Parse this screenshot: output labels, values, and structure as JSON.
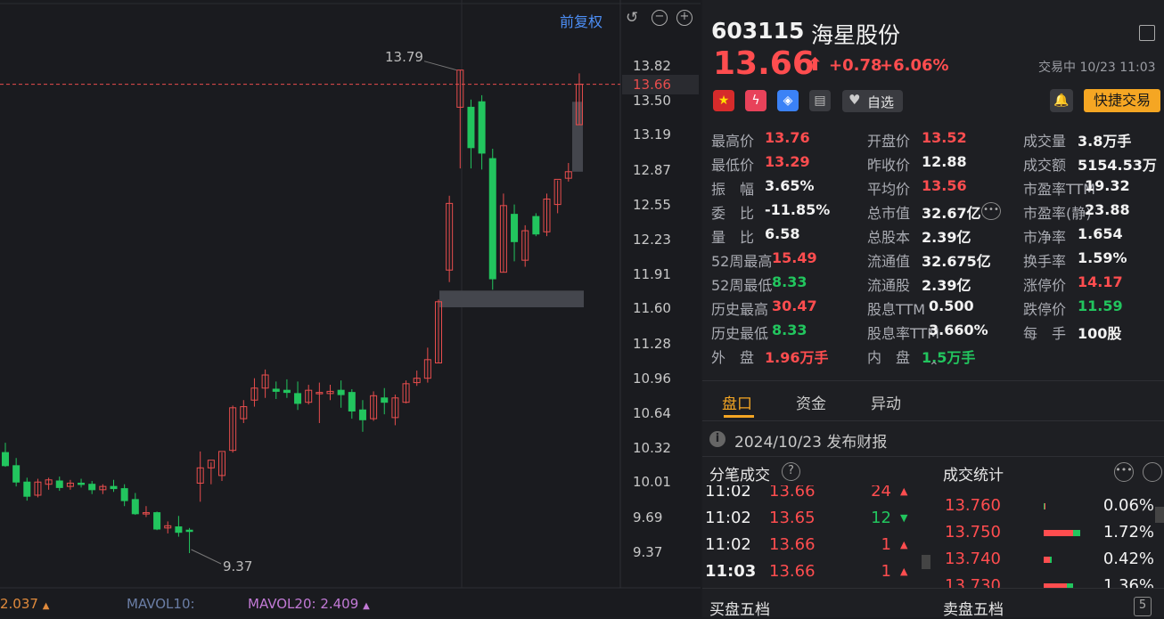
{
  "chart": {
    "adjust_label": "前复权",
    "price_ticks": [
      "13.82",
      "13.50",
      "13.19",
      "12.87",
      "12.55",
      "12.23",
      "11.91",
      "11.60",
      "11.28",
      "10.96",
      "10.64",
      "10.32",
      "10.01",
      "9.69",
      "9.37"
    ],
    "current_price_tag": "13.66",
    "high_marker": "13.79",
    "low_marker": "9.37",
    "vol_indicators": {
      "v1": "2.037",
      "mavol10_label": "MAVOL10:",
      "mavol20_label": "MAVOL20:",
      "mavol20_value": "2.409"
    },
    "colors": {
      "up": "#e84d4d",
      "down": "#22c55e",
      "price_line": "#e84d4d"
    }
  },
  "chart_data": {
    "type": "candlestick",
    "ylim": [
      9.37,
      13.82
    ],
    "candles": [
      {
        "o": 10.29,
        "h": 10.38,
        "l": 10.16,
        "c": 10.17
      },
      {
        "o": 10.17,
        "h": 10.24,
        "l": 9.98,
        "c": 10.02
      },
      {
        "o": 10.02,
        "h": 10.06,
        "l": 9.85,
        "c": 9.89
      },
      {
        "o": 9.9,
        "h": 10.05,
        "l": 9.88,
        "c": 10.02
      },
      {
        "o": 10.0,
        "h": 10.06,
        "l": 9.95,
        "c": 10.04
      },
      {
        "o": 10.03,
        "h": 10.07,
        "l": 9.94,
        "c": 9.97
      },
      {
        "o": 9.98,
        "h": 10.04,
        "l": 9.95,
        "c": 10.01
      },
      {
        "o": 10.01,
        "h": 10.05,
        "l": 9.97,
        "c": 10.0
      },
      {
        "o": 10.0,
        "h": 10.03,
        "l": 9.91,
        "c": 9.95
      },
      {
        "o": 9.95,
        "h": 10.0,
        "l": 9.91,
        "c": 9.98
      },
      {
        "o": 9.98,
        "h": 10.04,
        "l": 9.93,
        "c": 9.96
      },
      {
        "o": 9.96,
        "h": 10.0,
        "l": 9.8,
        "c": 9.85
      },
      {
        "o": 9.86,
        "h": 9.92,
        "l": 9.72,
        "c": 9.73
      },
      {
        "o": 9.74,
        "h": 9.8,
        "l": 9.7,
        "c": 9.74
      },
      {
        "o": 9.74,
        "h": 9.75,
        "l": 9.58,
        "c": 9.59
      },
      {
        "o": 9.6,
        "h": 9.66,
        "l": 9.55,
        "c": 9.62
      },
      {
        "o": 9.61,
        "h": 9.71,
        "l": 9.52,
        "c": 9.56
      },
      {
        "o": 9.58,
        "h": 9.6,
        "l": 9.37,
        "c": 9.57
      },
      {
        "o": 10.01,
        "h": 10.3,
        "l": 9.84,
        "c": 10.15
      },
      {
        "o": 10.15,
        "h": 10.2,
        "l": 10.0,
        "c": 10.22
      },
      {
        "o": 10.08,
        "h": 10.29,
        "l": 10.03,
        "c": 10.3
      },
      {
        "o": 10.31,
        "h": 10.72,
        "l": 10.29,
        "c": 10.7
      },
      {
        "o": 10.6,
        "h": 10.77,
        "l": 10.56,
        "c": 10.71
      },
      {
        "o": 10.77,
        "h": 10.97,
        "l": 10.71,
        "c": 10.88
      },
      {
        "o": 10.88,
        "h": 11.05,
        "l": 10.79,
        "c": 11.0
      },
      {
        "o": 10.87,
        "h": 10.94,
        "l": 10.78,
        "c": 10.85
      },
      {
        "o": 10.86,
        "h": 10.96,
        "l": 10.79,
        "c": 10.84
      },
      {
        "o": 10.83,
        "h": 10.94,
        "l": 10.68,
        "c": 10.74
      },
      {
        "o": 10.75,
        "h": 10.91,
        "l": 10.73,
        "c": 10.86
      },
      {
        "o": 10.84,
        "h": 10.93,
        "l": 10.56,
        "c": 10.84
      },
      {
        "o": 10.83,
        "h": 10.91,
        "l": 10.77,
        "c": 10.85
      },
      {
        "o": 10.86,
        "h": 10.95,
        "l": 10.7,
        "c": 10.82
      },
      {
        "o": 10.84,
        "h": 10.87,
        "l": 10.6,
        "c": 10.67
      },
      {
        "o": 10.68,
        "h": 10.77,
        "l": 10.48,
        "c": 10.59
      },
      {
        "o": 10.6,
        "h": 10.85,
        "l": 10.58,
        "c": 10.81
      },
      {
        "o": 10.79,
        "h": 10.88,
        "l": 10.64,
        "c": 10.75
      },
      {
        "o": 10.61,
        "h": 10.82,
        "l": 10.54,
        "c": 10.79
      },
      {
        "o": 10.75,
        "h": 10.95,
        "l": 10.74,
        "c": 10.92
      },
      {
        "o": 10.93,
        "h": 11.04,
        "l": 10.9,
        "c": 10.97
      },
      {
        "o": 10.97,
        "h": 11.25,
        "l": 10.93,
        "c": 11.14
      },
      {
        "o": 11.11,
        "h": 11.69,
        "l": 11.11,
        "c": 11.67
      },
      {
        "o": 11.96,
        "h": 12.64,
        "l": 11.85,
        "c": 12.57
      },
      {
        "o": 13.45,
        "h": 13.79,
        "l": 12.89,
        "c": 13.79
      },
      {
        "o": 13.45,
        "h": 13.52,
        "l": 12.89,
        "c": 13.08
      },
      {
        "o": 13.5,
        "h": 13.56,
        "l": 12.88,
        "c": 13.03
      },
      {
        "o": 12.98,
        "h": 13.07,
        "l": 11.78,
        "c": 11.88
      },
      {
        "o": 11.94,
        "h": 12.66,
        "l": 11.94,
        "c": 12.55
      },
      {
        "o": 12.47,
        "h": 12.56,
        "l": 12.04,
        "c": 12.22
      },
      {
        "o": 12.05,
        "h": 12.37,
        "l": 11.99,
        "c": 12.32
      },
      {
        "o": 12.45,
        "h": 12.48,
        "l": 12.27,
        "c": 12.29
      },
      {
        "o": 12.31,
        "h": 12.66,
        "l": 12.27,
        "c": 12.61
      },
      {
        "o": 12.56,
        "h": 12.78,
        "l": 12.48,
        "c": 12.79
      },
      {
        "o": 12.8,
        "h": 12.94,
        "l": 12.77,
        "c": 12.86
      },
      {
        "o": 13.29,
        "h": 13.76,
        "l": 13.29,
        "c": 13.66
      }
    ]
  },
  "quote": {
    "code": "603115",
    "name": "海星股份",
    "price": "13.66",
    "arrow": "⬆",
    "change": "+0.78",
    "change_pct": "+6.06%",
    "status": "交易中 10/23 11:03",
    "watch_label": "自选",
    "quick_trade": "快捷交易",
    "fields": [
      {
        "label": "最高价",
        "value": "13.76",
        "color": "red"
      },
      {
        "label": "开盘价",
        "value": "13.52",
        "color": "red"
      },
      {
        "label": "成交量",
        "value": "3.8万手",
        "color": "white"
      },
      {
        "label": "最低价",
        "value": "13.29",
        "color": "red"
      },
      {
        "label": "昨收价",
        "value": "12.88",
        "color": "white"
      },
      {
        "label": "成交额",
        "value": "5154.53万",
        "color": "white"
      },
      {
        "label": "振　幅",
        "value": "3.65%",
        "color": "white"
      },
      {
        "label": "平均价",
        "value": "13.56",
        "color": "red"
      },
      {
        "label": "市盈率TTM",
        "value": "19.32",
        "color": "white"
      },
      {
        "label": "委　比",
        "value": "-11.85%",
        "color": "white"
      },
      {
        "label": "总市值",
        "value": "32.67亿",
        "color": "white"
      },
      {
        "label": "市盈率(静)",
        "value": "23.88",
        "color": "white"
      },
      {
        "label": "量　比",
        "value": "6.58",
        "color": "white"
      },
      {
        "label": "总股本",
        "value": "2.39亿",
        "color": "white"
      },
      {
        "label": "市净率",
        "value": "1.654",
        "color": "white"
      },
      {
        "label": "52周最高",
        "value": "15.49",
        "color": "red"
      },
      {
        "label": "流通值",
        "value": "32.675亿",
        "color": "white"
      },
      {
        "label": "换手率",
        "value": "1.59%",
        "color": "white"
      },
      {
        "label": "52周最低",
        "value": "8.33",
        "color": "green"
      },
      {
        "label": "流通股",
        "value": "2.39亿",
        "color": "white"
      },
      {
        "label": "涨停价",
        "value": "14.17",
        "color": "red"
      },
      {
        "label": "历史最高",
        "value": "30.47",
        "color": "red"
      },
      {
        "label": "股息TTM",
        "value": "0.500",
        "color": "white"
      },
      {
        "label": "跌停价",
        "value": "11.59",
        "color": "green"
      },
      {
        "label": "历史最低",
        "value": "8.33",
        "color": "green"
      },
      {
        "label": "股息率TTM",
        "value": "3.660%",
        "color": "white"
      },
      {
        "label": "每　手",
        "value": "100股",
        "color": "white"
      },
      {
        "label": "外　盘",
        "value": "1.96万手",
        "color": "red"
      },
      {
        "label": "内　盘",
        "value": "1.5万手",
        "color": "green"
      }
    ]
  },
  "tabs": [
    "盘口",
    "资金",
    "异动"
  ],
  "notice": "2024/10/23  发布财报",
  "ticks": {
    "title": "分笔成交",
    "rows": [
      {
        "time": "11:02",
        "price": "13.66",
        "vol": "24",
        "dir": "up"
      },
      {
        "time": "11:02",
        "price": "13.65",
        "vol": "12",
        "dir": "down"
      },
      {
        "time": "11:02",
        "price": "13.66",
        "vol": "1",
        "dir": "up"
      },
      {
        "time": "11:03",
        "price": "13.66",
        "vol": "1",
        "dir": "up"
      }
    ]
  },
  "stats": {
    "title": "成交统计",
    "rows": [
      {
        "price": "13.760",
        "pct": "0.06%",
        "frac": 0.0006
      },
      {
        "price": "13.750",
        "pct": "1.72%",
        "frac": 0.0172
      },
      {
        "price": "13.740",
        "pct": "0.42%",
        "frac": 0.0042
      },
      {
        "price": "13.730",
        "pct": "1.36%",
        "frac": 0.0136
      }
    ]
  },
  "bottom": {
    "buy_label": "买盘五档",
    "sell_label": "卖盘五档",
    "key_label": "5"
  }
}
